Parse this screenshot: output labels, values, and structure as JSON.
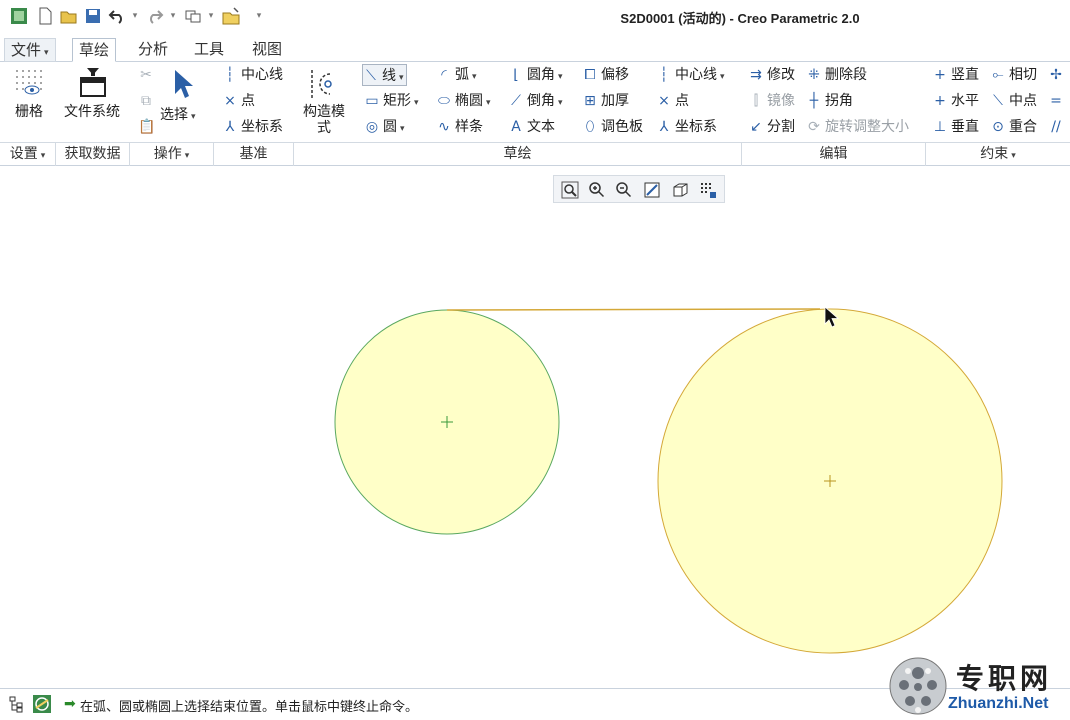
{
  "window": {
    "title": "S2D0001 (活动的) - Creo Parametric 2.0"
  },
  "tabs": [
    {
      "label": "文件"
    },
    {
      "label": "草绘"
    },
    {
      "label": "分析"
    },
    {
      "label": "工具"
    },
    {
      "label": "视图"
    }
  ],
  "ribbon": {
    "grid": "栅格",
    "file_system": "文件系统",
    "select": "选择",
    "datum_centerline": "中心线",
    "datum_point": "点",
    "datum_csys": "坐标系",
    "construction_mode": "构造模式",
    "line": "线",
    "rectangle": "矩形",
    "circle": "圆",
    "arc": "弧",
    "ellipse": "椭圆",
    "spline": "样条",
    "fillet": "圆角",
    "chamfer": "倒角",
    "text": "文本",
    "offset": "偏移",
    "thicken": "加厚",
    "palette": "调色板",
    "sketch_centerline": "中心线",
    "sketch_point": "点",
    "sketch_csys": "坐标系",
    "modify": "修改",
    "mirror": "镜像",
    "divide": "分割",
    "delete_segment": "删除段",
    "corner": "拐角",
    "rotate_resize": "旋转调整大小",
    "vertical": "竖直",
    "horizontal": "水平",
    "perpendicular": "垂直",
    "tangent": "相切",
    "midpoint": "中点",
    "coincident": "重合"
  },
  "groups": [
    {
      "label": "设置"
    },
    {
      "label": "获取数据"
    },
    {
      "label": "操作"
    },
    {
      "label": "基准"
    },
    {
      "label": "草绘"
    },
    {
      "label": "编辑"
    },
    {
      "label": "约束"
    }
  ],
  "status": {
    "message": "在弧、圆或椭圆上选择结束位置。单击鼠标中键终止命令。"
  },
  "watermark": {
    "cn": "专职网",
    "en": "Zhuanzhi.Net"
  },
  "colors": {
    "circle_fill": "#ffffc8",
    "small_circle_stroke": "#5aa860",
    "large_circle_stroke": "#d4a838",
    "tangent_line": "#d4a838",
    "center_mark": "#3a9a3a",
    "icon_blue": "#2b5fa6"
  }
}
